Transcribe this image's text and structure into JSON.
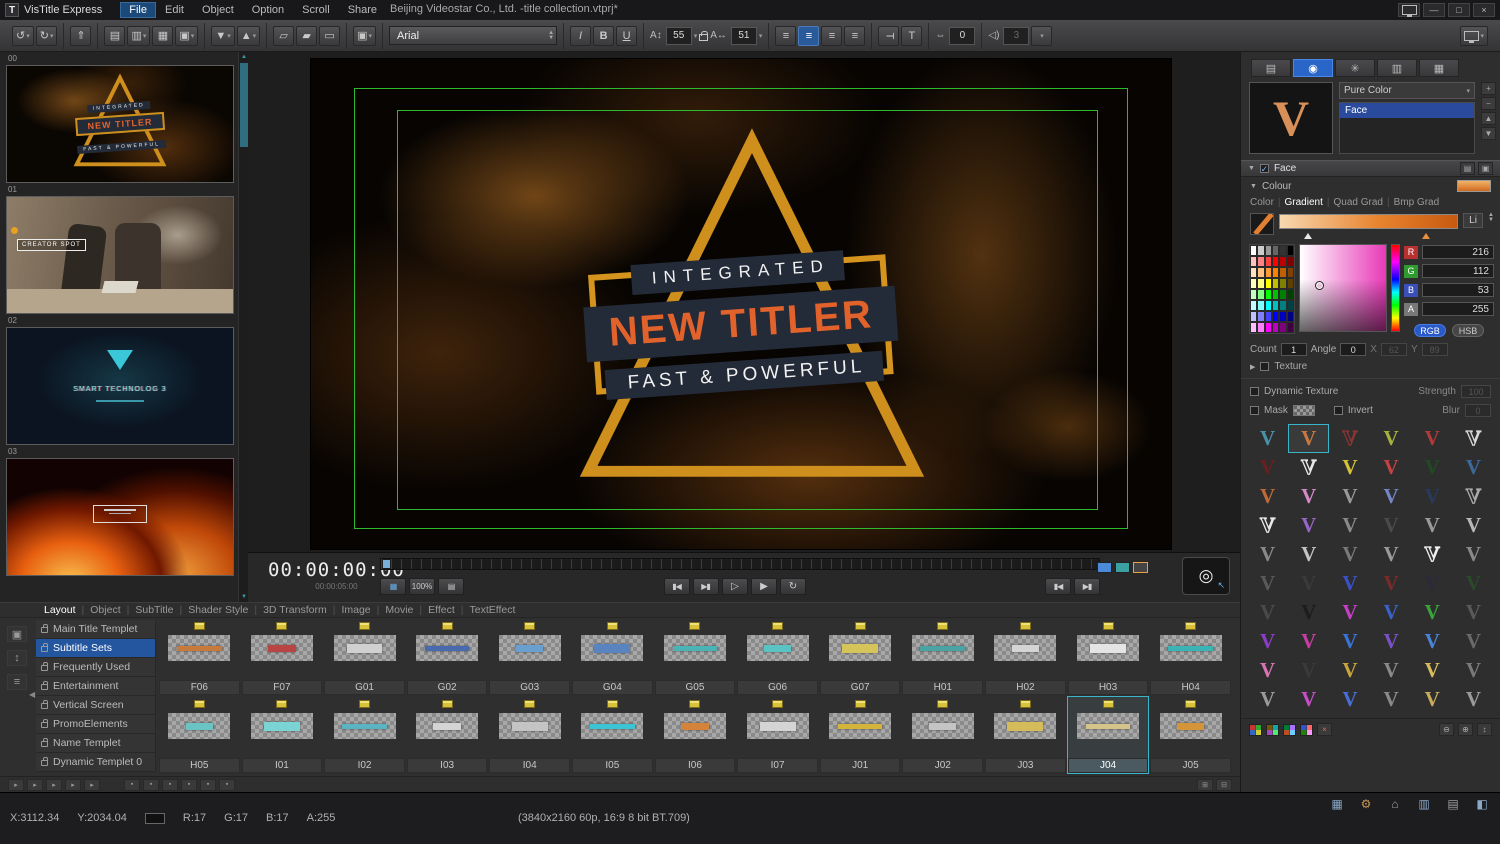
{
  "window": {
    "logo_letter": "T",
    "app_name": "VisTitle Express",
    "menus": [
      "File",
      "Edit",
      "Object",
      "Option",
      "Scroll",
      "Share"
    ],
    "active_menu": "File",
    "title": "Beijing Videostar Co., Ltd. -title collection.vtprj*"
  },
  "toolbar": {
    "font_name": "Arial",
    "font_size": "55",
    "char_width": "51",
    "char_spacing": "0",
    "audio_value": "3"
  },
  "library": {
    "items": [
      {
        "index": "00"
      },
      {
        "index": "01",
        "caption": "CREATOR SPOT"
      },
      {
        "index": "02",
        "caption": "SMART TECHNOLOG 3"
      },
      {
        "index": "03"
      }
    ]
  },
  "preview": {
    "line1": "INTEGRATED",
    "line2": "NEW TITLER",
    "line3": "FAST & POWERFUL"
  },
  "timeline": {
    "timecode": "00:00:00:00",
    "duration": "00:00:05:00",
    "zoom": "100%"
  },
  "browser": {
    "tabs": [
      "Layout",
      "Object",
      "SubTitle",
      "Shader Style",
      "3D Transform",
      "Image",
      "Movie",
      "Effect",
      "TextEffect"
    ],
    "active_tab": "Layout",
    "categories": [
      "Main Title Templet",
      "Subtitle Sets",
      "Frequently Used",
      "Entertainment",
      "Vertical Screen",
      "PromoElements",
      "Name Templet",
      "Dynamic Templet 0"
    ],
    "selected_category": "Subtitle Sets",
    "selected_template": "J04",
    "rows": [
      {
        "cells": [
          {
            "id": "F06",
            "accent": "#c87a3a"
          },
          {
            "id": "F07",
            "accent": "#b84444"
          },
          {
            "id": "G01",
            "accent": "#d0d0d0"
          },
          {
            "id": "G02",
            "accent": "#4a6ab0"
          },
          {
            "id": "G03",
            "accent": "#6aa0d0"
          },
          {
            "id": "G04",
            "accent": "#5a84c0"
          },
          {
            "id": "G05",
            "accent": "#4ab4b4"
          },
          {
            "id": "G06",
            "accent": "#5ac4c4"
          },
          {
            "id": "G07",
            "accent": "#d4c45a"
          },
          {
            "id": "H01",
            "accent": "#4aa4a4"
          },
          {
            "id": "H02",
            "accent": "#d4d4d4"
          },
          {
            "id": "H03",
            "accent": "#e4e4e4"
          },
          {
            "id": "H04",
            "accent": "#3ab4b4"
          }
        ]
      },
      {
        "cells": [
          {
            "id": "H05",
            "accent": "#6ac4c4"
          },
          {
            "id": "I01",
            "accent": "#7ad4d4"
          },
          {
            "id": "I02",
            "accent": "#5ab4c4"
          },
          {
            "id": "I03",
            "accent": "#d4d4d4"
          },
          {
            "id": "I04",
            "accent": "#c4c4c4"
          },
          {
            "id": "I05",
            "accent": "#3ac4d4"
          },
          {
            "id": "I06",
            "accent": "#d4843a"
          },
          {
            "id": "I07",
            "accent": "#d4d4d4"
          },
          {
            "id": "J01",
            "accent": "#d4b43a"
          },
          {
            "id": "J02",
            "accent": "#c4c4c4"
          },
          {
            "id": "J03",
            "accent": "#d4bc5a"
          },
          {
            "id": "J04",
            "accent": "#d4c48a"
          },
          {
            "id": "J05",
            "accent": "#d4943a"
          }
        ]
      }
    ]
  },
  "inspector": {
    "preview_letter": "V",
    "fill_type": "Pure Color",
    "layers": [
      "Face"
    ],
    "selected_layer": "Face",
    "section_title": "Face",
    "colour_label": "Colour",
    "grad_tabs": [
      "Color",
      "Gradient",
      "Quad Grad",
      "Bmp Grad"
    ],
    "active_grad_tab": "Gradient",
    "grad_mode": "Li",
    "channels": [
      {
        "label": "R",
        "value": "216",
        "color": "#b83030"
      },
      {
        "label": "G",
        "value": "112",
        "color": "#2f9a2f"
      },
      {
        "label": "B",
        "value": "53",
        "color": "#3a50b8"
      },
      {
        "label": "A",
        "value": "255",
        "color": "#787878"
      }
    ],
    "mode_rgb": "RGB",
    "mode_hsb": "HSB",
    "count_label": "Count",
    "count_value": "1",
    "angle_label": "Angle",
    "angle_value": "0",
    "x_label": "X",
    "x_value": "62",
    "y_label": "Y",
    "y_value": "89",
    "texture_label": "Texture",
    "dynamic_texture_label": "Dynamic Texture",
    "strength_label": "Strength",
    "strength_value": "100",
    "mask_label": "Mask",
    "invert_label": "Invert",
    "blur_label": "Blur",
    "blur_value": "0",
    "palette": [
      "#ffffff",
      "#cccccc",
      "#999999",
      "#666666",
      "#333333",
      "#000000",
      "#ffc0c0",
      "#ff8080",
      "#ff4040",
      "#ff0000",
      "#c00000",
      "#800000",
      "#ffe0c0",
      "#ffc080",
      "#ff9933",
      "#ff8000",
      "#c06000",
      "#804000",
      "#ffffc0",
      "#ffff80",
      "#ffff00",
      "#c0c000",
      "#808000",
      "#604000",
      "#c0ffc0",
      "#80ff80",
      "#00ff00",
      "#00c000",
      "#008000",
      "#004000",
      "#c0ffff",
      "#80ffff",
      "#00ffff",
      "#00c0c0",
      "#008080",
      "#004040",
      "#c0c0ff",
      "#8080ff",
      "#4040ff",
      "#0000ff",
      "#0000c0",
      "#000080",
      "#ffc0ff",
      "#ff80ff",
      "#ff00ff",
      "#c000c0",
      "#800080",
      "#400040"
    ],
    "styles": [
      {
        "c": "#4a90a8"
      },
      {
        "c": "#c8793f"
      },
      {
        "c": "#8a3434",
        "o": 1
      },
      {
        "c": "#a8b03c"
      },
      {
        "c": "#b23a3a"
      },
      {
        "c": "#d8d8d8",
        "o": 1
      },
      {
        "c": "#6a2020"
      },
      {
        "c": "#e8e8e8",
        "o": 1
      },
      {
        "c": "#d4c234"
      },
      {
        "c": "#c44242"
      },
      {
        "c": "#224a22"
      },
      {
        "c": "#3a6a9a"
      },
      {
        "c": "#c06a3a"
      },
      {
        "c": "#d488c8"
      },
      {
        "c": "#989898"
      },
      {
        "c": "#7486c8"
      },
      {
        "c": "#2a3a5c"
      },
      {
        "c": "#aaaaaa",
        "o": 1
      },
      {
        "c": "#e8e8e8",
        "o": 1
      },
      {
        "c": "#9866c8"
      },
      {
        "c": "#8a8a8a"
      },
      {
        "c": "#4a4a4a"
      },
      {
        "c": "#9a9a9a"
      },
      {
        "c": "#b8b8b8"
      },
      {
        "c": "#8a8a8a"
      },
      {
        "c": "#c4c4c4"
      },
      {
        "c": "#7a7a7a"
      },
      {
        "c": "#9a9a9a"
      },
      {
        "c": "#f0f0f0",
        "o": 1
      },
      {
        "c": "#8a8a8a"
      },
      {
        "c": "#5a5a5a"
      },
      {
        "c": "#3a3a3a"
      },
      {
        "c": "#3a52c8"
      },
      {
        "c": "#7a2a2a"
      },
      {
        "c": "#2a2a3c"
      },
      {
        "c": "#2a4a2a"
      },
      {
        "c": "#4a4a4a"
      },
      {
        "c": "#1c1c1c"
      },
      {
        "c": "#c83ec8"
      },
      {
        "c": "#3a62c8"
      },
      {
        "c": "#3aa43a"
      },
      {
        "c": "#5a5a5a"
      },
      {
        "c": "#8a3ec8"
      },
      {
        "c": "#c83ea4"
      },
      {
        "c": "#3a74d8"
      },
      {
        "c": "#7a52c8"
      },
      {
        "c": "#4a84d8"
      },
      {
        "c": "#6a6a6a"
      },
      {
        "c": "#d874b4"
      },
      {
        "c": "#3a3a3a"
      },
      {
        "c": "#c8a43a"
      },
      {
        "c": "#8a8a8a"
      },
      {
        "c": "#d8bc5c"
      },
      {
        "c": "#7a7a7a"
      },
      {
        "c": "#9a9a9a"
      },
      {
        "c": "#c84ec8"
      },
      {
        "c": "#4a6ed8"
      },
      {
        "c": "#8a8a8a"
      },
      {
        "c": "#c8ac5c"
      },
      {
        "c": "#9a9a9a"
      }
    ],
    "selected_style_index": 1
  },
  "status": {
    "x": "X:3112.34",
    "y": "Y:2034.04",
    "r": "R:17",
    "g": "G:17",
    "b": "B:17",
    "a": "A:255",
    "format": "(3840x2160 60p, 16:9 8 bit BT.709)"
  }
}
